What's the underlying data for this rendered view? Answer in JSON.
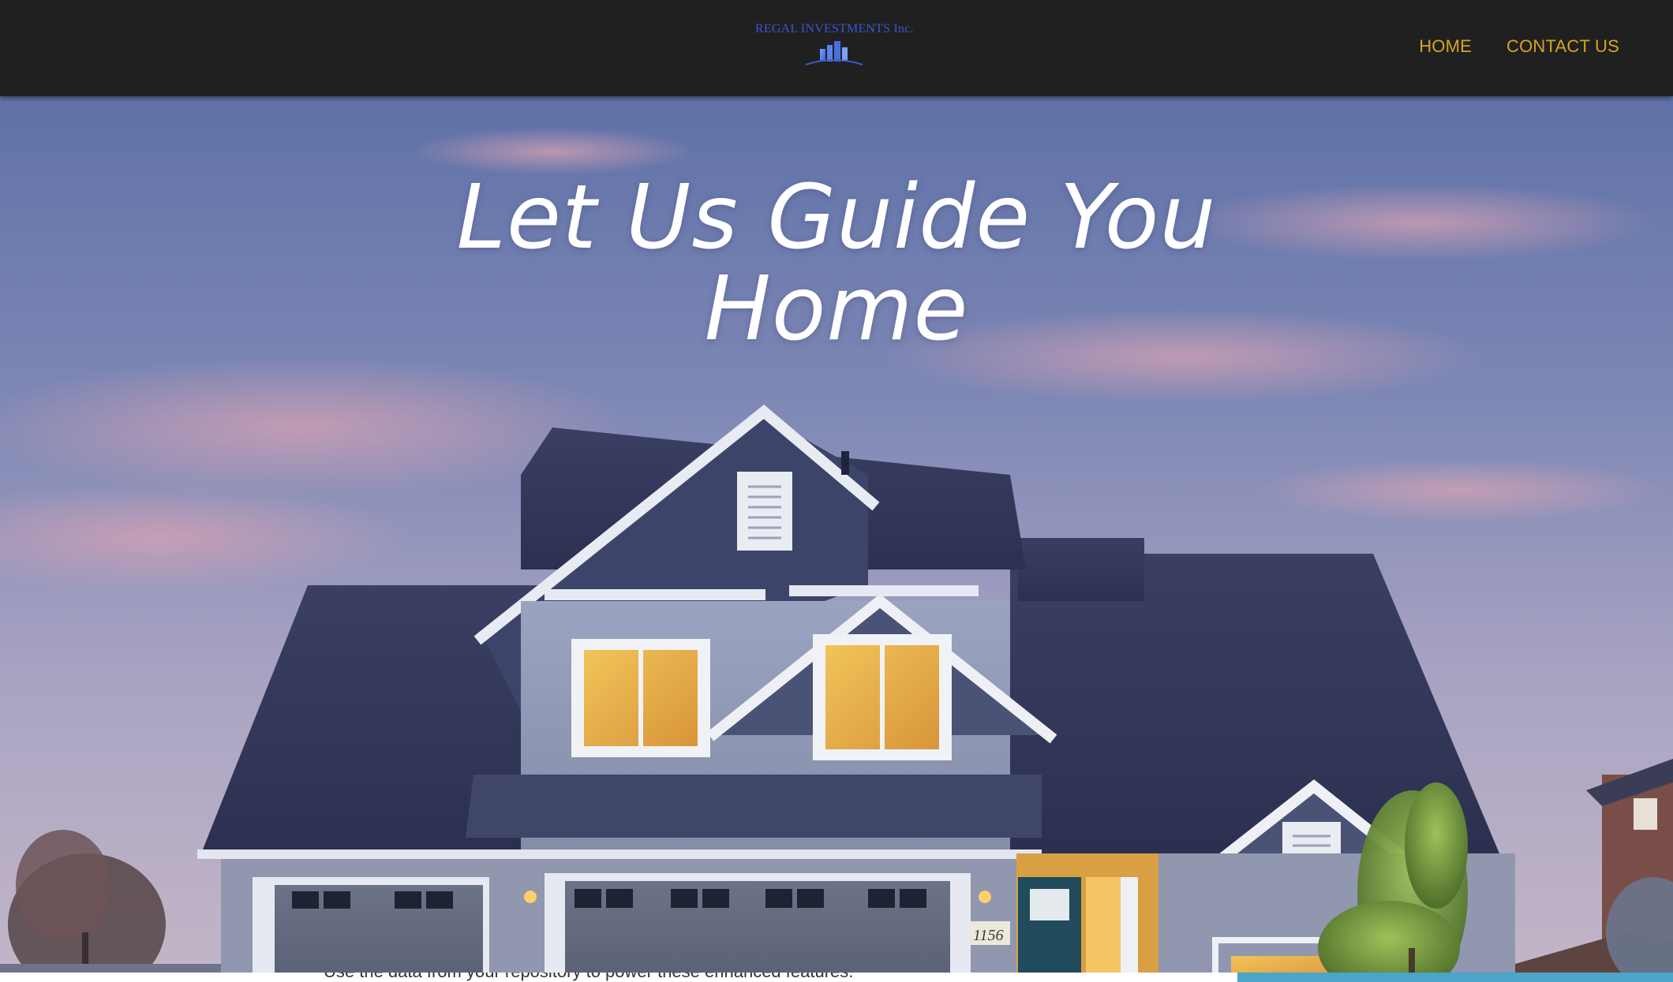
{
  "header": {
    "logo_text": "REGAL INVESTMENTS Inc.",
    "logo_icon": "city-skyline-icon",
    "nav": [
      {
        "label": "HOME"
      },
      {
        "label": "CONTACT US"
      }
    ]
  },
  "hero": {
    "title": "Let Us Guide You Home",
    "house_number": "1156"
  },
  "footer_peek": {
    "text": "Use the data from your repository to power these enhanced features."
  },
  "colors": {
    "header_bg": "#202020",
    "nav_link": "#d6a51e",
    "logo_text": "#3b55d6",
    "hero_title": "#ffffff",
    "panel_accent": "#4aa5c9"
  }
}
